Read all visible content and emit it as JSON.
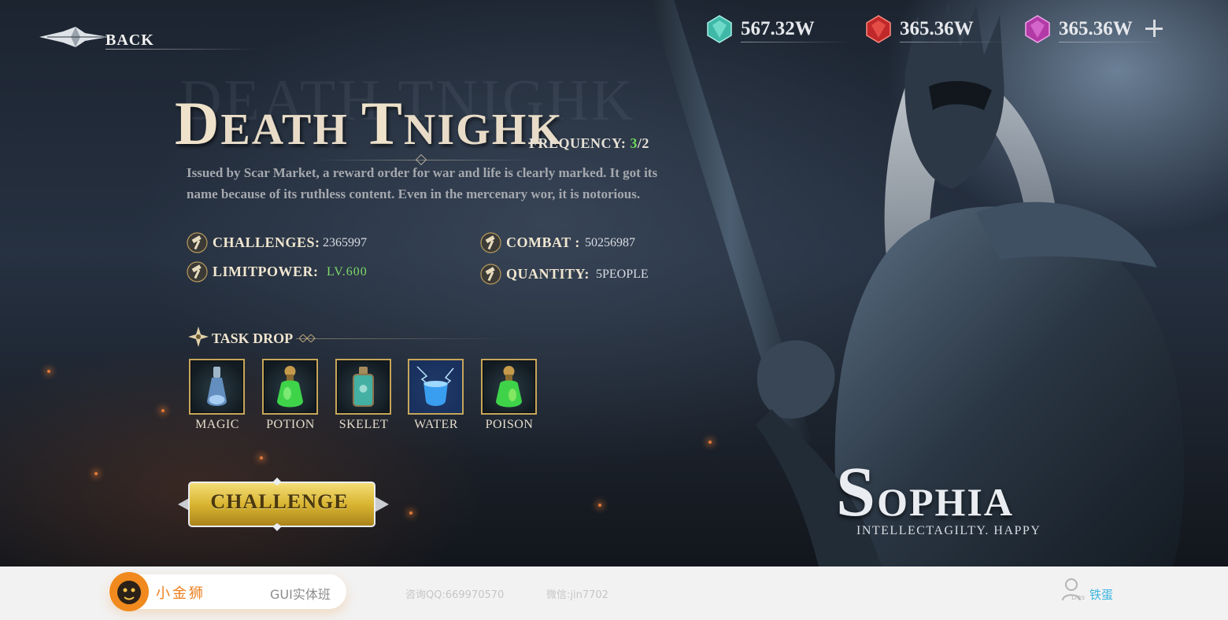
{
  "nav": {
    "back_label": "BACK"
  },
  "currencies": [
    {
      "name": "teal-gem",
      "value": "567.32W",
      "color": "#3fb8a8"
    },
    {
      "name": "red-gem",
      "value": "365.36W",
      "color": "#c0282a"
    },
    {
      "name": "purple-gem",
      "value": "365.36W",
      "color": "#b23aa6"
    }
  ],
  "mission": {
    "watermark": "DEATH TNIGHK",
    "title_cap_1": "D",
    "title_rest_1": "EATH ",
    "title_cap_2": "T",
    "title_rest_2": "NIGHK",
    "frequency_label": "FREQUENCY:",
    "frequency_current": "3",
    "frequency_separator": "/",
    "frequency_total": "2",
    "description": "Issued by Scar Market, a reward order for war and life is clearly marked. It got its name because of its ruthless content. Even in the mercenary wor, it is notorious.",
    "stats": {
      "challenges_label": "CHALLENGES:",
      "challenges_value": "2365997",
      "combat_label": "COMBAT :",
      "combat_value": "50256987",
      "limitpower_label": "LIMITPOWER:",
      "limitpower_value": "LV.600",
      "quantity_label": "QUANTITY:",
      "quantity_value": "5PEOPLE"
    },
    "task_drop_label": "TASK DROP",
    "drops": [
      {
        "name": "MAGIC",
        "icon": "magic-bottle-icon",
        "color": "#7fb3e6"
      },
      {
        "name": "POTION",
        "icon": "potion-flask-icon",
        "color": "#3fd34a"
      },
      {
        "name": "SKELET",
        "icon": "skelet-jar-icon",
        "color": "#4ac7b6"
      },
      {
        "name": "WATER",
        "icon": "water-flask-icon",
        "color": "#3a9ef0"
      },
      {
        "name": "POISON",
        "icon": "poison-flask-icon",
        "color": "#3fd34a"
      }
    ],
    "challenge_button": "CHALLENGE"
  },
  "hero": {
    "name_cap": "S",
    "name_rest": "OPHIA",
    "subtitle": "INTELLECTAGILTY. HAPPY"
  },
  "footer": {
    "brand": "小金狮",
    "course": "GUI实体班",
    "qq": "咨询QQ:669970570",
    "wechat": "微信:jin7702",
    "user_tag": "Des",
    "user_name": "铁蛋"
  },
  "colors": {
    "accent_gold": "#c7a75a",
    "frequency_current": "#6ed65b",
    "limitpower": "#7fdc6a",
    "brand_orange": "#f07f1e",
    "user_blue": "#3bb6e0"
  }
}
